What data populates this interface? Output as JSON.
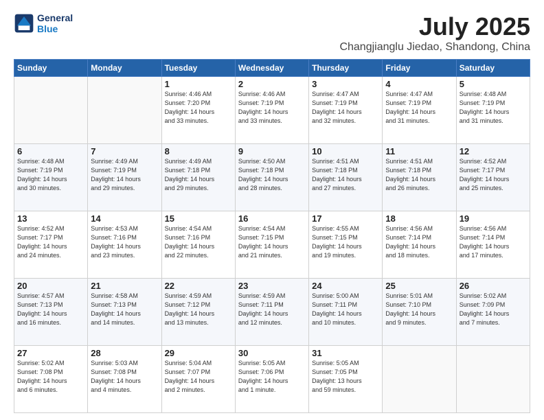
{
  "header": {
    "logo_line1": "General",
    "logo_line2": "Blue",
    "main_title": "July 2025",
    "subtitle": "Changjianglu Jiedao, Shandong, China"
  },
  "days_of_week": [
    "Sunday",
    "Monday",
    "Tuesday",
    "Wednesday",
    "Thursday",
    "Friday",
    "Saturday"
  ],
  "weeks": [
    [
      {
        "day": "",
        "info": ""
      },
      {
        "day": "",
        "info": ""
      },
      {
        "day": "1",
        "info": "Sunrise: 4:46 AM\nSunset: 7:20 PM\nDaylight: 14 hours\nand 33 minutes."
      },
      {
        "day": "2",
        "info": "Sunrise: 4:46 AM\nSunset: 7:19 PM\nDaylight: 14 hours\nand 33 minutes."
      },
      {
        "day": "3",
        "info": "Sunrise: 4:47 AM\nSunset: 7:19 PM\nDaylight: 14 hours\nand 32 minutes."
      },
      {
        "day": "4",
        "info": "Sunrise: 4:47 AM\nSunset: 7:19 PM\nDaylight: 14 hours\nand 31 minutes."
      },
      {
        "day": "5",
        "info": "Sunrise: 4:48 AM\nSunset: 7:19 PM\nDaylight: 14 hours\nand 31 minutes."
      }
    ],
    [
      {
        "day": "6",
        "info": "Sunrise: 4:48 AM\nSunset: 7:19 PM\nDaylight: 14 hours\nand 30 minutes."
      },
      {
        "day": "7",
        "info": "Sunrise: 4:49 AM\nSunset: 7:19 PM\nDaylight: 14 hours\nand 29 minutes."
      },
      {
        "day": "8",
        "info": "Sunrise: 4:49 AM\nSunset: 7:18 PM\nDaylight: 14 hours\nand 29 minutes."
      },
      {
        "day": "9",
        "info": "Sunrise: 4:50 AM\nSunset: 7:18 PM\nDaylight: 14 hours\nand 28 minutes."
      },
      {
        "day": "10",
        "info": "Sunrise: 4:51 AM\nSunset: 7:18 PM\nDaylight: 14 hours\nand 27 minutes."
      },
      {
        "day": "11",
        "info": "Sunrise: 4:51 AM\nSunset: 7:18 PM\nDaylight: 14 hours\nand 26 minutes."
      },
      {
        "day": "12",
        "info": "Sunrise: 4:52 AM\nSunset: 7:17 PM\nDaylight: 14 hours\nand 25 minutes."
      }
    ],
    [
      {
        "day": "13",
        "info": "Sunrise: 4:52 AM\nSunset: 7:17 PM\nDaylight: 14 hours\nand 24 minutes."
      },
      {
        "day": "14",
        "info": "Sunrise: 4:53 AM\nSunset: 7:16 PM\nDaylight: 14 hours\nand 23 minutes."
      },
      {
        "day": "15",
        "info": "Sunrise: 4:54 AM\nSunset: 7:16 PM\nDaylight: 14 hours\nand 22 minutes."
      },
      {
        "day": "16",
        "info": "Sunrise: 4:54 AM\nSunset: 7:15 PM\nDaylight: 14 hours\nand 21 minutes."
      },
      {
        "day": "17",
        "info": "Sunrise: 4:55 AM\nSunset: 7:15 PM\nDaylight: 14 hours\nand 19 minutes."
      },
      {
        "day": "18",
        "info": "Sunrise: 4:56 AM\nSunset: 7:14 PM\nDaylight: 14 hours\nand 18 minutes."
      },
      {
        "day": "19",
        "info": "Sunrise: 4:56 AM\nSunset: 7:14 PM\nDaylight: 14 hours\nand 17 minutes."
      }
    ],
    [
      {
        "day": "20",
        "info": "Sunrise: 4:57 AM\nSunset: 7:13 PM\nDaylight: 14 hours\nand 16 minutes."
      },
      {
        "day": "21",
        "info": "Sunrise: 4:58 AM\nSunset: 7:13 PM\nDaylight: 14 hours\nand 14 minutes."
      },
      {
        "day": "22",
        "info": "Sunrise: 4:59 AM\nSunset: 7:12 PM\nDaylight: 14 hours\nand 13 minutes."
      },
      {
        "day": "23",
        "info": "Sunrise: 4:59 AM\nSunset: 7:11 PM\nDaylight: 14 hours\nand 12 minutes."
      },
      {
        "day": "24",
        "info": "Sunrise: 5:00 AM\nSunset: 7:11 PM\nDaylight: 14 hours\nand 10 minutes."
      },
      {
        "day": "25",
        "info": "Sunrise: 5:01 AM\nSunset: 7:10 PM\nDaylight: 14 hours\nand 9 minutes."
      },
      {
        "day": "26",
        "info": "Sunrise: 5:02 AM\nSunset: 7:09 PM\nDaylight: 14 hours\nand 7 minutes."
      }
    ],
    [
      {
        "day": "27",
        "info": "Sunrise: 5:02 AM\nSunset: 7:08 PM\nDaylight: 14 hours\nand 6 minutes."
      },
      {
        "day": "28",
        "info": "Sunrise: 5:03 AM\nSunset: 7:08 PM\nDaylight: 14 hours\nand 4 minutes."
      },
      {
        "day": "29",
        "info": "Sunrise: 5:04 AM\nSunset: 7:07 PM\nDaylight: 14 hours\nand 2 minutes."
      },
      {
        "day": "30",
        "info": "Sunrise: 5:05 AM\nSunset: 7:06 PM\nDaylight: 14 hours\nand 1 minute."
      },
      {
        "day": "31",
        "info": "Sunrise: 5:05 AM\nSunset: 7:05 PM\nDaylight: 13 hours\nand 59 minutes."
      },
      {
        "day": "",
        "info": ""
      },
      {
        "day": "",
        "info": ""
      }
    ]
  ]
}
